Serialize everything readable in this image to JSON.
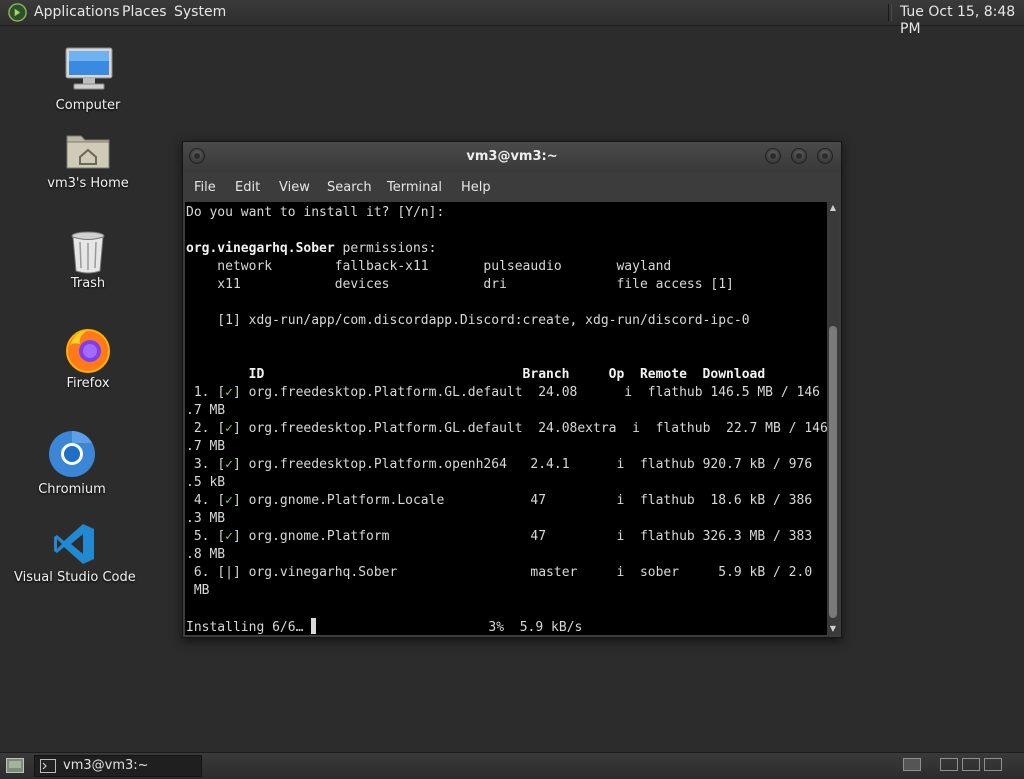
{
  "top_panel": {
    "menus": [
      "Applications",
      "Places",
      "System"
    ],
    "clock": "Tue Oct 15,  8:48 PM"
  },
  "desktop": {
    "icons": [
      {
        "label": "Computer",
        "icon": "computer-icon"
      },
      {
        "label": "vm3's Home",
        "icon": "home-folder-icon"
      },
      {
        "label": "Trash",
        "icon": "trash-icon"
      },
      {
        "label": "Firefox",
        "icon": "firefox-icon"
      },
      {
        "label": "Chromium",
        "icon": "chromium-icon"
      },
      {
        "label": "Visual Studio Code",
        "icon": "vscode-icon"
      }
    ]
  },
  "terminal": {
    "title": "vm3@vm3:~",
    "menu": [
      "File",
      "Edit",
      "View",
      "Search",
      "Terminal",
      "Help"
    ],
    "lines": {
      "prompt": "Do you want to install it? [Y/n]:",
      "app_id": "org.vinegarhq.Sober",
      "permissions_suffix": " permissions:",
      "perm_row1": "    network        fallback-x11       pulseaudio       wayland",
      "perm_row2": "    x11            devices            dri              file access [1]",
      "footnote": "    [1] xdg-run/app/com.discordapp.Discord:create, xdg-run/discord-ipc-0",
      "header": "        ID                                 Branch     Op  Remote  Download",
      "rows": [
        {
          "num": " 1. ",
          "mark": "✓",
          "text": " org.freedesktop.Platform.GL.default  24.08      i  flathub 146.5 MB / 146",
          "wrap": ".7 MB"
        },
        {
          "num": " 2. ",
          "mark": "✓",
          "text": " org.freedesktop.Platform.GL.default  24.08extra  i  flathub  22.7 MB / 146",
          "wrap": ".7 MB"
        },
        {
          "num": " 3. ",
          "mark": "✓",
          "text": " org.freedesktop.Platform.openh264   2.4.1      i  flathub 920.7 kB / 976",
          "wrap": ".5 kB"
        },
        {
          "num": " 4. ",
          "mark": "✓",
          "text": " org.gnome.Platform.Locale           47         i  flathub  18.6 kB / 386",
          "wrap": ".3 MB"
        },
        {
          "num": " 5. ",
          "mark": "✓",
          "text": " org.gnome.Platform                  47         i  flathub 326.3 MB / 383",
          "wrap": ".8 MB"
        },
        {
          "num": " 6. ",
          "mark": "|",
          "text": " org.vinegarhq.Sober                 master     i  sober     5.9 kB / 2.0",
          "wrap": " MB"
        }
      ],
      "status_left": "Installing 6/6… ",
      "status_right": "                      3%  5.9 kB/s"
    }
  },
  "bottom_panel": {
    "task_label": "vm3@vm3:~"
  },
  "colors": {
    "desktop_bg": "#2c2c2c",
    "terminal_bg": "#000000",
    "check_green": "#7fd36a",
    "vscode_blue": "#1f8ad2"
  }
}
